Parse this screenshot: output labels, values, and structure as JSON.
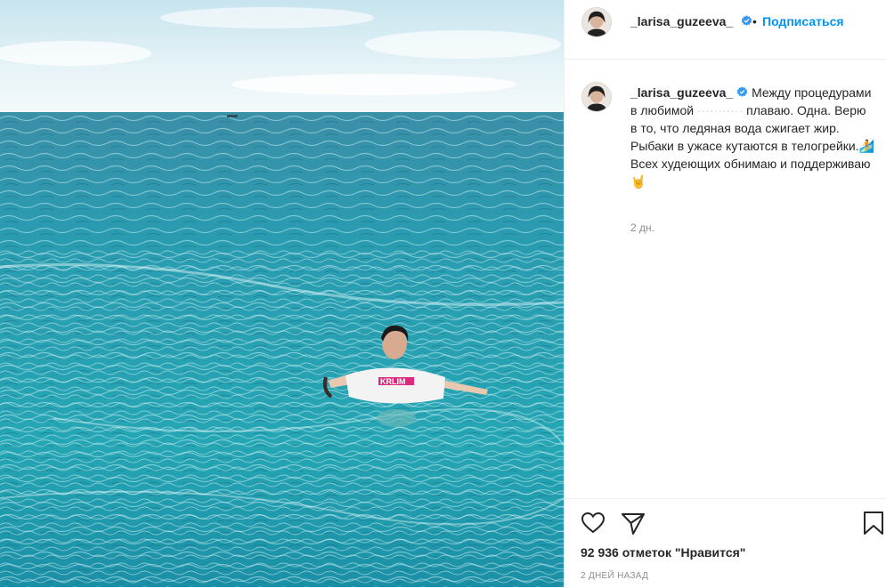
{
  "post": {
    "username": "_larisa_guzeeva_",
    "follow_label": "Подписаться",
    "separator": "•",
    "caption_part1": "Между процедурами в любимой ",
    "caption_blurred": "···········",
    "caption_part2": " плаваю. Одна. Верю в то, что ледяная вода сжигает жир. Рыбаки в ужасе кутаются в телогрейки.",
    "caption_emoji1": "🏄",
    "caption_part3": "Всех худеющих обнимаю и поддерживаю",
    "caption_emoji2": "🤘",
    "caption_time": "2 дн.",
    "likes_text": "92 936 отметок \"Нравится\"",
    "date_text": "2 дней назад"
  },
  "photo": {
    "shirt_text": "KRLIM",
    "colors": {
      "sky": "#dbeef4",
      "sea": "#1f98ad",
      "sea_dark": "#0e6f86"
    }
  },
  "icons": [
    "verified-badge-icon",
    "heart-icon",
    "share-plane-icon",
    "bookmark-icon"
  ],
  "colors": {
    "accent": "#0095f6",
    "text": "#262626",
    "muted": "#8e8e8e"
  }
}
